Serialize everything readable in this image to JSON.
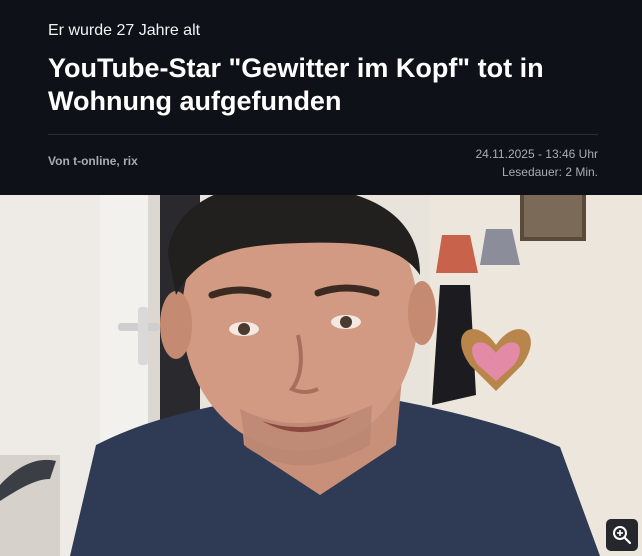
{
  "article": {
    "kicker": "Er wurde 27 Jahre alt",
    "headline": "YouTube-Star \"Gewitter im Kopf\" tot in Wohnung aufgefunden",
    "byline": "Von t-online, rix",
    "date": "24.11.2025 - 13:46 Uhr",
    "reading_time": "Lesedauer: 2 Min."
  },
  "image": {
    "zoom_icon": "zoom-in-icon",
    "subject": "man-portrait-photo"
  },
  "colors": {
    "header_bg": "#0e1117",
    "headline": "#ffffff",
    "meta_text": "#a9adb3",
    "shirt": "#2e3a52"
  }
}
